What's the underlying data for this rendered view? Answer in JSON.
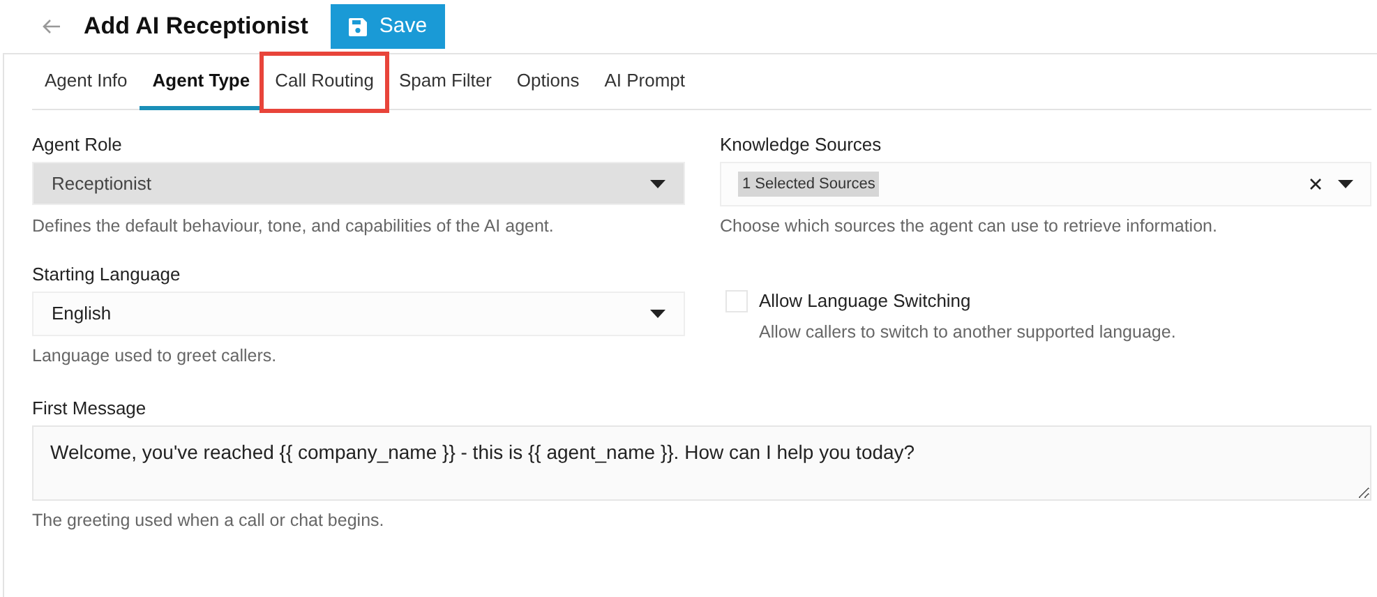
{
  "header": {
    "title": "Add AI Receptionist",
    "save_button": "Save"
  },
  "tabs": [
    {
      "label": "Agent Info",
      "selected": false,
      "highlighted": false
    },
    {
      "label": "Agent Type",
      "selected": true,
      "highlighted": false
    },
    {
      "label": "Call Routing",
      "selected": false,
      "highlighted": true
    },
    {
      "label": "Spam Filter",
      "selected": false,
      "highlighted": false
    },
    {
      "label": "Options",
      "selected": false,
      "highlighted": false
    },
    {
      "label": "AI Prompt",
      "selected": false,
      "highlighted": false
    }
  ],
  "agent_role": {
    "label": "Agent Role",
    "value": "Receptionist",
    "disabled": true,
    "help": "Defines the default behaviour, tone, and capabilities of the AI agent."
  },
  "knowledge_sources": {
    "label": "Knowledge Sources",
    "tag": "1 Selected Sources",
    "help": "Choose which sources the agent can use to retrieve information."
  },
  "starting_language": {
    "label": "Starting Language",
    "value": "English",
    "disabled": false,
    "help": "Language used to greet callers."
  },
  "allow_language_switching": {
    "label": "Allow Language Switching",
    "checked": false,
    "help": "Allow callers to switch to another supported language."
  },
  "first_message": {
    "label": "First Message",
    "value": "Welcome, you've reached {{ company_name }} - this is {{ agent_name }}. How can I help you today?",
    "help": "The greeting used when a call or chat begins."
  }
}
